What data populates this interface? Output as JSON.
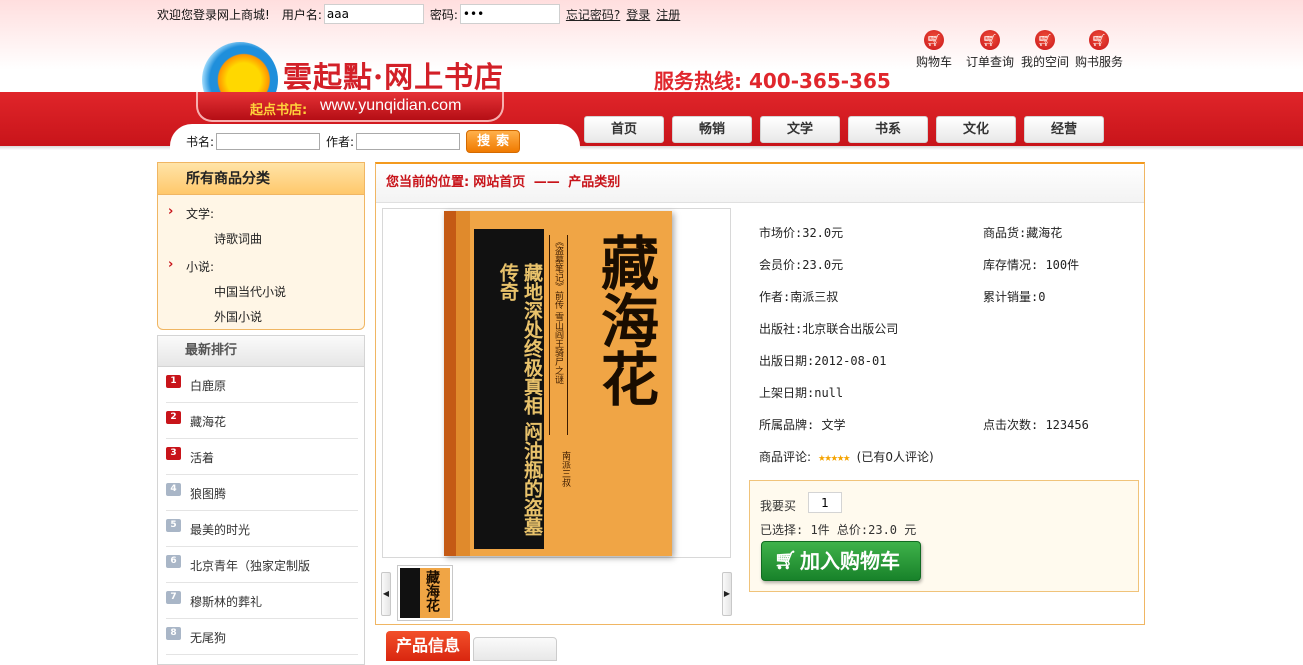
{
  "login": {
    "welcome": "欢迎您登录网上商城!",
    "username_label": "用户名:",
    "username_value": "aaa",
    "password_label": "密码:",
    "password_value": "•••",
    "forgot": "忘记密码?",
    "login": "登录",
    "register": "注册"
  },
  "brand": {
    "title": "雲起點·网上书店",
    "slogan": "起点书店:",
    "url": "www.yunqidian.com",
    "hotline": "服务热线: 400-365-365"
  },
  "quick_links": [
    {
      "label": "购物车",
      "icon": "cart-icon"
    },
    {
      "label": "订单查询",
      "icon": "cart-icon"
    },
    {
      "label": "我的空间",
      "icon": "cart-icon"
    },
    {
      "label": "购书服务",
      "icon": "cart-icon"
    }
  ],
  "search": {
    "book_label": "书名:",
    "author_label": "作者:",
    "button": "搜索"
  },
  "nav": [
    "首页",
    "畅销",
    "文学",
    "书系",
    "文化",
    "经营"
  ],
  "categories": {
    "title": "所有商品分类",
    "groups": [
      {
        "name": "文学:",
        "subs": [
          "诗歌词曲"
        ]
      },
      {
        "name": "小说:",
        "subs": [
          "中国当代小说",
          "外国小说"
        ]
      }
    ]
  },
  "ranking": {
    "title": "最新排行",
    "items": [
      "白鹿原",
      "藏海花",
      "活着",
      "狼图腾",
      "最美的时光",
      "北京青年（独家定制版",
      "穆斯林的葬礼",
      "无尾狗"
    ]
  },
  "breadcrumb": {
    "prefix": "您当前的位置:",
    "home": "网站首页",
    "sep": "——",
    "current": "产品类别"
  },
  "book_cover": {
    "title": "藏海花",
    "slogan": "藏地深处终极真相 闷油瓶的盗墓传奇",
    "side": "《盗墓笔记》前传 雪山阎王骑尸之谜",
    "author": "南派三叔"
  },
  "product": {
    "market_price": "市场价:32.0元",
    "member_price": "会员价:23.0元",
    "author": "作者:南派三叔",
    "publisher": "出版社:北京联合出版公司",
    "pub_date": "出版日期:2012-08-01",
    "shelf_date": "上架日期:null",
    "brand": "所属品牌: 文学",
    "review_label": "商品评论:",
    "review_stars": "★★★★★",
    "review_text": "(已有0人评论)",
    "goods": "商品货:藏海花",
    "stock": "库存情况: 100件",
    "sales": "累计销量:0",
    "clicks": "点击次数: 123456",
    "review_rating": 5
  },
  "buy": {
    "qty_label": "我要买",
    "qty_value": "1",
    "selected": "已选择: 1件 总价:23.0 元",
    "add_cart": "加入购物车"
  },
  "tabs": {
    "info": "产品信息"
  },
  "colors": {
    "brand_red": "#c8141a",
    "accent_orange": "#f39a1e",
    "cart_green": "#18822a"
  }
}
